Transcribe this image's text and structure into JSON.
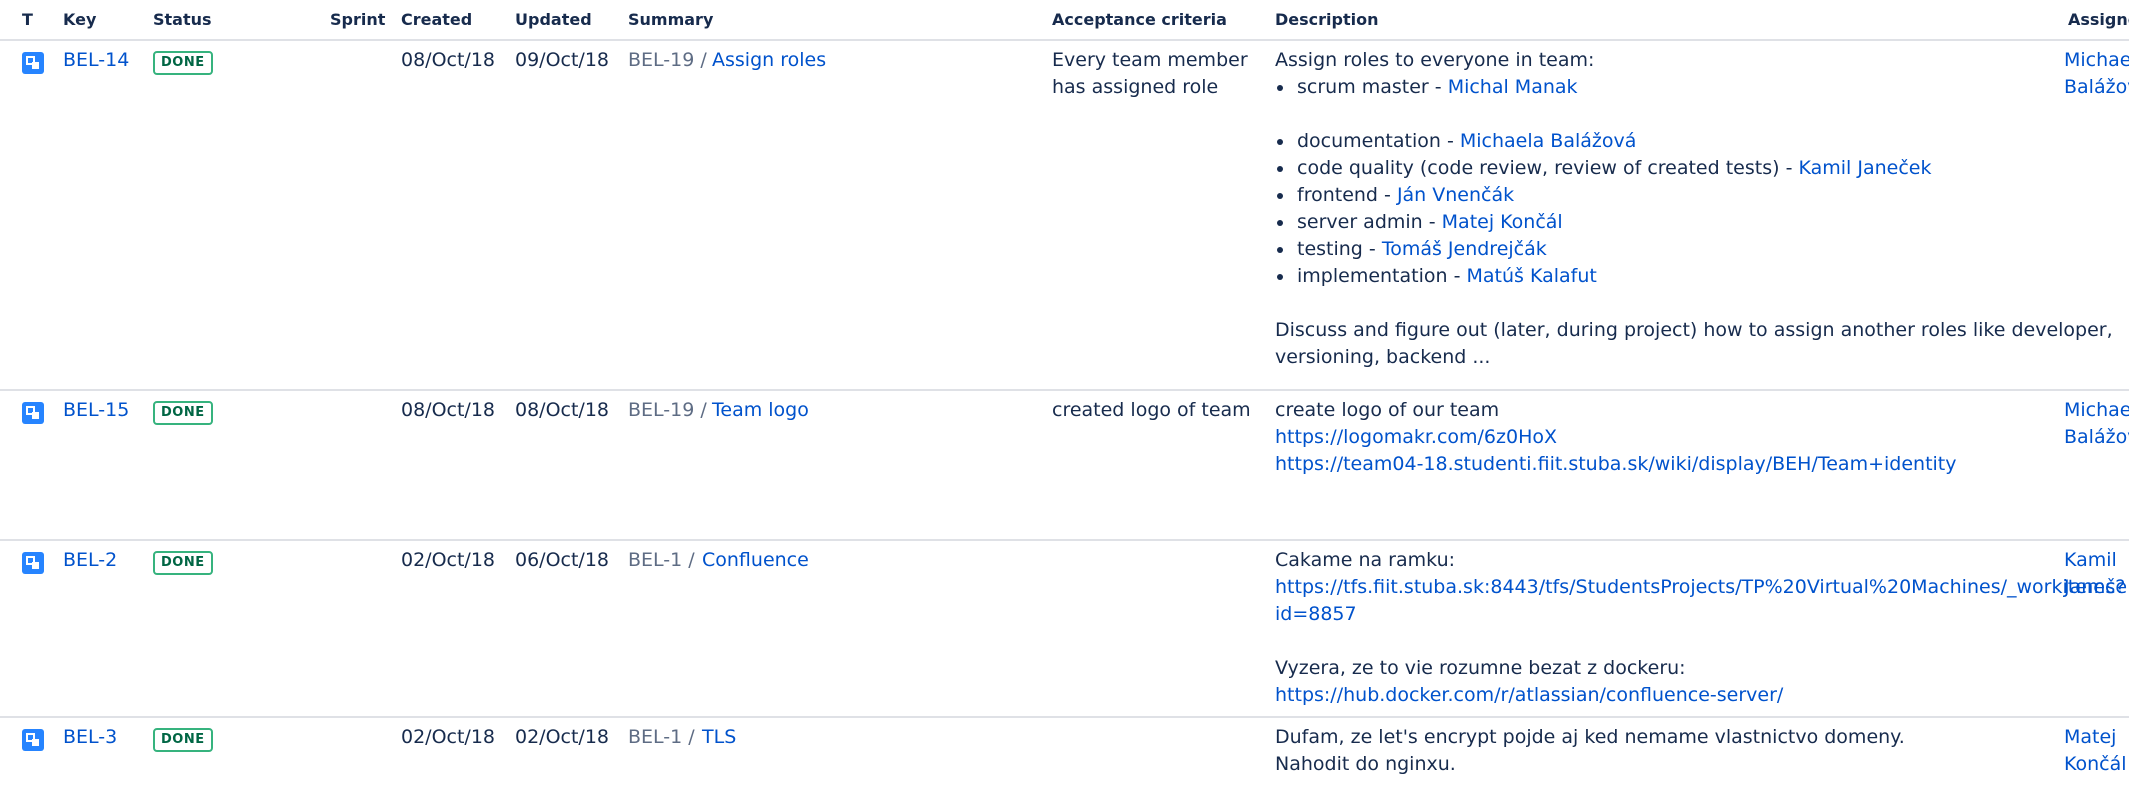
{
  "headers": {
    "t": "T",
    "key": "Key",
    "status": "Status",
    "sprint": "Sprint",
    "created": "Created",
    "updated": "Updated",
    "summary": "Summary",
    "acceptance": "Acceptance criteria",
    "description": "Description",
    "assignee": "Assignee"
  },
  "rows": [
    {
      "key": "BEL-14",
      "status": "DONE",
      "created": "08/Oct/18",
      "updated": "09/Oct/18",
      "parent": "BEL-19 /",
      "summary": "Assign roles",
      "acceptance": [
        "Every team member",
        "has assigned role"
      ],
      "description": {
        "intro": "Assign roles to everyone in team:",
        "bullets1": [
          {
            "role": "scrum master - ",
            "person": "Michal Manak"
          }
        ],
        "bullets2": [
          {
            "role": "documentation - ",
            "person": "Michaela Balážová"
          },
          {
            "role": "code quality (code review, review of created tests) - ",
            "person": "Kamil Janeček"
          },
          {
            "role": "frontend - ",
            "person": "Ján Vnenčák"
          },
          {
            "role": "server admin - ",
            "person": "Matej Končál"
          },
          {
            "role": "testing - ",
            "person": "Tomáš Jendrejčák"
          },
          {
            "role": "implementation - ",
            "person": "Matúš Kalafut"
          }
        ],
        "outro1": "Discuss and figure out (later, during project) how to assign another roles like developer,",
        "outro2": "versioning, backend ..."
      },
      "assignee": [
        "Michae",
        "Balážov"
      ]
    },
    {
      "key": "BEL-15",
      "status": "DONE",
      "created": "08/Oct/18",
      "updated": "08/Oct/18",
      "parent": "BEL-19 /",
      "summary": "Team logo",
      "acceptance": [
        "created logo of team"
      ],
      "description": {
        "line1": "create logo of our team",
        "link1": "https://logomakr.com/6z0HoX",
        "link2": "https://team04-18.studenti.fiit.stuba.sk/wiki/display/BEH/Team+identity"
      },
      "assignee": [
        "Michae",
        "Balážov"
      ]
    },
    {
      "key": "BEL-2",
      "status": "DONE",
      "created": "02/Oct/18",
      "updated": "06/Oct/18",
      "parent": "BEL-1 /",
      "summary": "Confluence",
      "description": {
        "line1": "Cakame na ramku:",
        "link1a": "https://tfs.fiit.stuba.sk:8443/tfs/StudentsProjects/TP%20Virtual%20Machines/_workitems?",
        "link1b": "id=8857",
        "line2": "Vyzera, ze to vie rozumne bezat z dockeru:",
        "link2": "https://hub.docker.com/r/atlassian/confluence-server/"
      },
      "assignee": [
        "Kamil",
        "Janeče"
      ]
    },
    {
      "key": "BEL-3",
      "status": "DONE",
      "created": "02/Oct/18",
      "updated": "02/Oct/18",
      "parent": "BEL-1 /",
      "summary": "TLS",
      "description": {
        "line1": "Dufam, ze let's encrypt pojde aj ked nemame vlastnictvo domeny.",
        "line2": "Nahodit do nginxu."
      },
      "assignee": [
        "Matej",
        "Končál"
      ]
    }
  ],
  "colors": {
    "link": "#0052cc",
    "text": "#172b4d",
    "muted": "#5e6c84",
    "done": "#36b37e",
    "border": "#dfe1e6",
    "story_icon": "#2684ff"
  },
  "icons": {
    "issue_type": "subtask-icon"
  }
}
